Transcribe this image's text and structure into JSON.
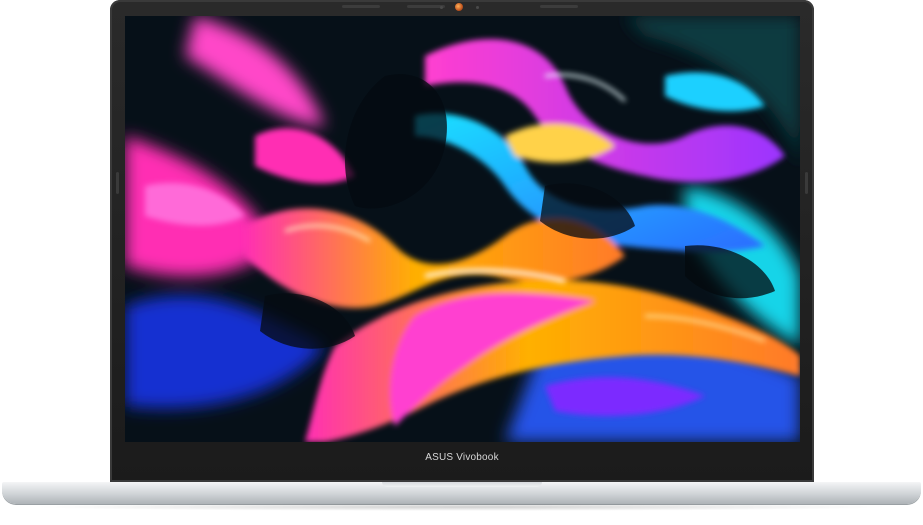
{
  "device": {
    "brand_label": "ASUS Vivobook",
    "icon": "laptop-icon",
    "screen_content": "abstract-wallpaper"
  },
  "colors": {
    "bezel": "#1b1b1b",
    "chassis": "#cfd3d6",
    "camera": "#c2561f",
    "wallpaper_palette": [
      "#ff2fb3",
      "#1ad0ff",
      "#ffb000",
      "#7b2cff",
      "#0a1a24"
    ]
  }
}
